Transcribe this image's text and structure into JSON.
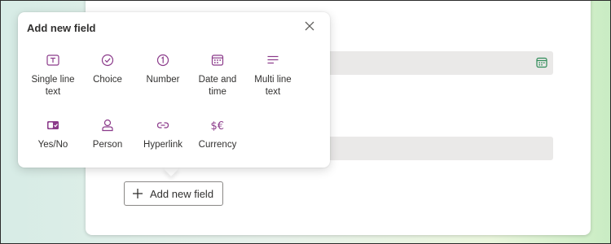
{
  "colors": {
    "accent": "#8b3a8a",
    "icon_green": "#2e8b57",
    "text": "#323130",
    "field_bg": "#eae9e8"
  },
  "popup": {
    "title": "Add new field",
    "close_icon": "close-icon",
    "field_types": [
      {
        "label": "Single line text",
        "icon": "text-box-icon"
      },
      {
        "label": "Choice",
        "icon": "circle-check-icon"
      },
      {
        "label": "Number",
        "icon": "circle-number-one-icon"
      },
      {
        "label": "Date and time",
        "icon": "calendar-icon"
      },
      {
        "label": "Multi line text",
        "icon": "text-lines-icon"
      },
      {
        "label": "Yes/No",
        "icon": "toggle-icon"
      },
      {
        "label": "Person",
        "icon": "person-icon"
      },
      {
        "label": "Hyperlink",
        "icon": "link-icon"
      },
      {
        "label": "Currency",
        "icon": "currency-icon"
      }
    ]
  },
  "form": {
    "date_field_icon": "calendar-icon",
    "add_button_label": "Add new field",
    "add_button_icon": "plus-icon"
  }
}
